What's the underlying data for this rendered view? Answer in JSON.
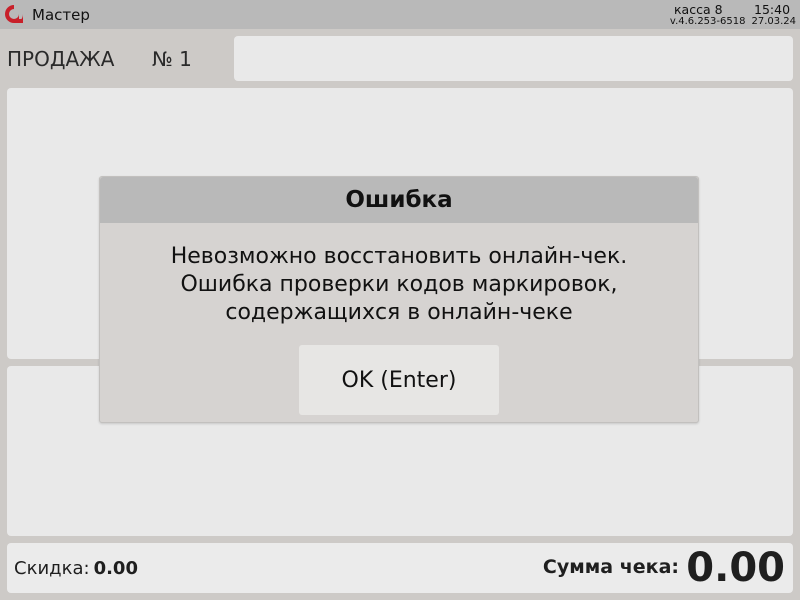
{
  "topbar": {
    "app_title": "Мастер",
    "register": "касса 8",
    "time": "15:40",
    "version": "v.4.6.253-6518",
    "date": "27.03.24",
    "logo_icon": "cashier-logo-icon",
    "logo_color": "#c8202a"
  },
  "sale": {
    "title": "ПРОДАЖА",
    "number": "№ 1"
  },
  "footer": {
    "discount_label": "Скидка:",
    "discount_value": "0.00",
    "total_label": "Сумма чека:",
    "total_value": "0.00"
  },
  "dialog": {
    "title": "Ошибка",
    "message_lines": [
      "Невозможно восстановить онлайн-чек.",
      "Ошибка проверки кодов маркировок,",
      "содержащихся в онлайн-чеке"
    ],
    "ok_label": "OK (Enter)"
  }
}
